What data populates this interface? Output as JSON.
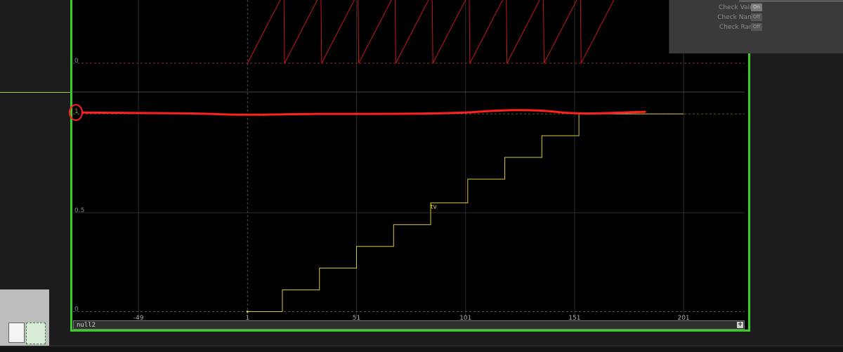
{
  "colors": {
    "viewer_border": "#3ccc2a",
    "ramp_channel": "#c81818",
    "steps_channel": "#d6cb3a",
    "annotation": "#ff2020",
    "grid": "#2c2c2c"
  },
  "params": [
    {
      "label": "Check Values",
      "state": "On"
    },
    {
      "label": "Check Names",
      "state": "Off"
    },
    {
      "label": "Check Range",
      "state": "Off"
    }
  ],
  "channel_name": "null2",
  "add_button_label": "+",
  "chart_data": {
    "type": "line",
    "xlim": [
      -79,
      229
    ],
    "x_ticks": [
      -49,
      1,
      51,
      101,
      151,
      201
    ],
    "upper_panel": {
      "zero_label": "0",
      "ramp_resets_at": [
        1,
        18,
        35,
        52,
        69,
        86,
        103,
        120,
        137,
        154
      ]
    },
    "lower_panel": {
      "ylim": [
        -0.03,
        1.1
      ],
      "y_ticks": [
        {
          "v": 0,
          "label": "0"
        },
        {
          "v": 0.5,
          "label": "0.5"
        },
        {
          "v": 1,
          "label": "1"
        }
      ],
      "series": [
        {
          "name": "tv",
          "type": "step",
          "x": [
            1,
            17,
            34,
            51,
            68,
            85,
            102,
            119,
            136,
            153
          ],
          "y": [
            0,
            0.11,
            0.22,
            0.33,
            0.44,
            0.55,
            0.67,
            0.78,
            0.89,
            1.0
          ]
        }
      ]
    }
  }
}
